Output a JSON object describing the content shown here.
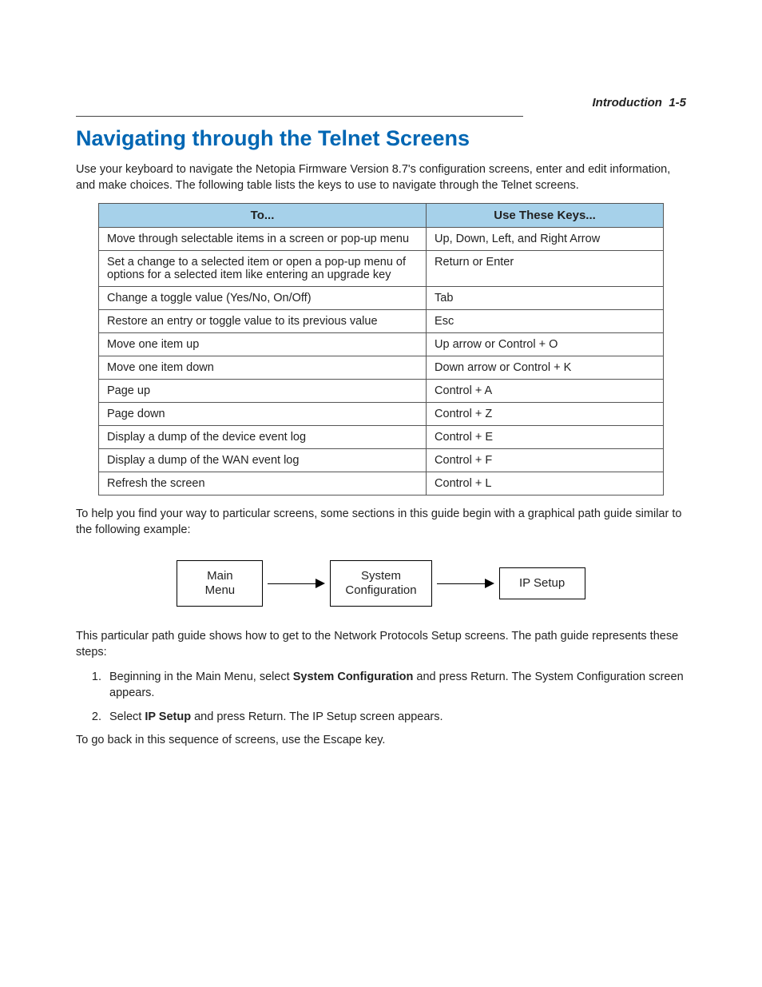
{
  "header": {
    "section": "Introduction",
    "page_ref": "1-5"
  },
  "title": "Navigating through the Telnet Screens",
  "intro_paragraph": "Use your keyboard to navigate the Netopia Firmware Version 8.7's configuration screens, enter and edit information, and make choices. The following table lists the keys to use to navigate through the Telnet screens.",
  "table": {
    "headers": {
      "col1": "To...",
      "col2": "Use These Keys..."
    },
    "rows": [
      {
        "to": "Move through selectable items in a screen or pop-up menu",
        "keys": "Up, Down, Left, and Right Arrow"
      },
      {
        "to": "Set a change to a selected item or open a pop-up menu of options for a selected item like entering an upgrade key",
        "keys": "Return or Enter"
      },
      {
        "to": "Change a toggle value (Yes/No, On/Off)",
        "keys": "Tab"
      },
      {
        "to": "Restore an entry or toggle value to its previous value",
        "keys": "Esc"
      },
      {
        "to": "Move one item up",
        "keys": "Up arrow or Control + O"
      },
      {
        "to": "Move one item down",
        "keys": "Down arrow or Control + K"
      },
      {
        "to": "Page up",
        "keys": "Control + A"
      },
      {
        "to": "Page down",
        "keys": "Control + Z"
      },
      {
        "to": "Display a dump of the device event log",
        "keys": "Control + E"
      },
      {
        "to": "Display a dump of the WAN event log",
        "keys": "Control + F"
      },
      {
        "to": "Refresh the screen",
        "keys": "Control + L"
      }
    ]
  },
  "after_table_paragraph": "To help you find your way to particular screens, some sections in this guide begin with a graphical path guide similar to the following example:",
  "path_guide": {
    "box1_line1": "Main",
    "box1_line2": "Menu",
    "box2_line1": "System",
    "box2_line2": "Configuration",
    "box3": "IP Setup"
  },
  "after_path_paragraph": "This particular path guide shows how to get to the Network Protocols Setup screens. The path guide represents these steps:",
  "steps": {
    "s1_pre": "Beginning in the Main Menu, select ",
    "s1_bold": "System Configuration",
    "s1_post": " and press Return. The System Configuration screen appears.",
    "s2_pre": "Select ",
    "s2_bold": "IP Setup",
    "s2_post": " and press Return. The IP Setup screen appears."
  },
  "closing_paragraph": "To go back in this sequence of screens, use the Escape key."
}
